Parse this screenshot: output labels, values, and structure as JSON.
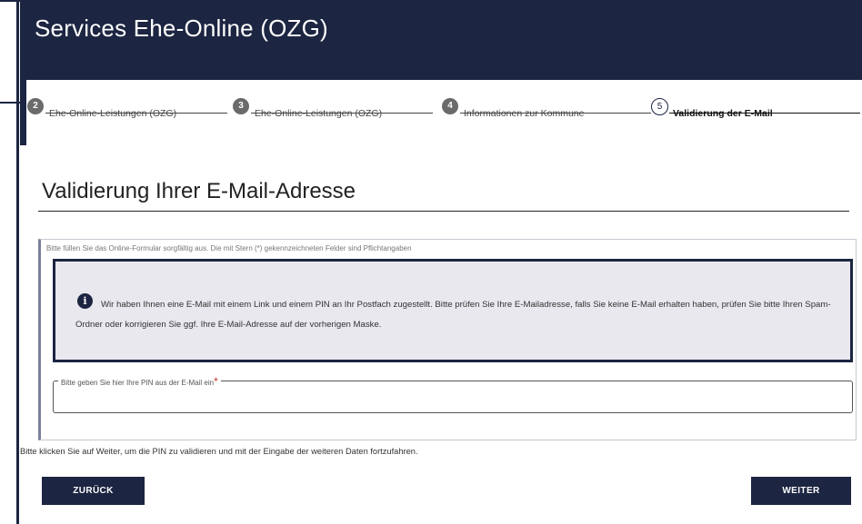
{
  "header": {
    "title": "Services Ehe-Online (OZG)"
  },
  "stepper": {
    "steps": [
      {
        "number": "2",
        "label": "Ehe-Online-Leistungen (OZG)"
      },
      {
        "number": "3",
        "label": "Ehe-Online-Leistungen (OZG)"
      },
      {
        "number": "4",
        "label": "Informationen zur Kommune"
      },
      {
        "number": "5",
        "label": "Validierung der E-Mail"
      }
    ]
  },
  "page": {
    "title": "Validierung Ihrer E-Mail-Adresse",
    "form_hint": "Bitte füllen Sie das Online-Formular sorgfältig aus. Die mit Stern (*) gekennzeichneten Felder sind Pflichtangaben",
    "info_icon": "i",
    "info_text": "Wir haben Ihnen eine E-Mail mit einem Link und einem PIN an Ihr Postfach zugestellt. Bitte prüfen Sie Ihre E-Mailadresse, falls Sie keine E-Mail erhalten haben, prüfen Sie bitte Ihren Spam-Ordner oder korrigieren Sie ggf. Ihre E-Mail-Adresse auf der vorherigen Maske.",
    "pin_label": "Bitte geben Sie hier Ihre PIN aus der E-Mail ein",
    "pin_required": "*",
    "pin_value": "",
    "instruction": "Bitte klicken Sie auf Weiter, um die PIN zu validieren und mit der Eingabe der weiteren Daten fortzufahren."
  },
  "buttons": {
    "back": "ZURÜCK",
    "next": "WEITER"
  },
  "colors": {
    "primary": "#1c2541",
    "info_bg": "#e8e8ee",
    "required": "#c0392b"
  }
}
